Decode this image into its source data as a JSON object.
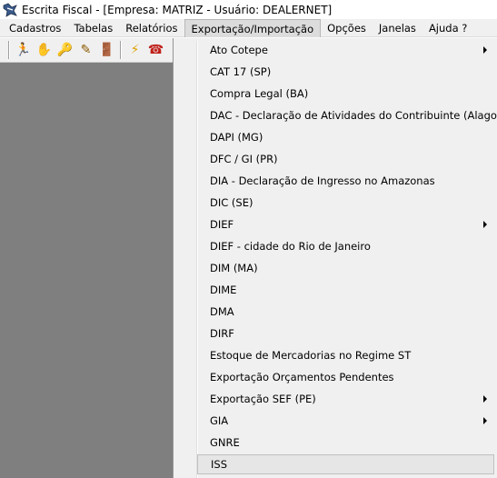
{
  "window": {
    "title": "Escrita Fiscal - [Empresa: MATRIZ - Usuário: DEALERNET]"
  },
  "menubar": {
    "items": [
      {
        "label": "Cadastros"
      },
      {
        "label": "Tabelas"
      },
      {
        "label": "Relatórios"
      },
      {
        "label": "Exportação/Importação"
      },
      {
        "label": "Opções"
      },
      {
        "label": "Janelas"
      },
      {
        "label": "Ajuda ?"
      }
    ],
    "active_index": 3
  },
  "toolbar": {
    "buttons": [
      {
        "icon": "runner-exit-icon",
        "glyph": "🏃"
      },
      {
        "icon": "hand-icon",
        "glyph": "✋"
      },
      {
        "icon": "door-key-icon",
        "glyph": "🔑"
      },
      {
        "icon": "pencil-edit-icon",
        "glyph": "✎"
      },
      {
        "icon": "door-exit-icon",
        "glyph": "🚪"
      },
      {
        "icon": "lightning-icon",
        "glyph": "⚡"
      },
      {
        "icon": "telephone-icon",
        "glyph": "☎"
      }
    ]
  },
  "dropdown": {
    "items": [
      {
        "label": "Ato Cotepe",
        "submenu": true
      },
      {
        "label": "CAT 17 (SP)",
        "submenu": false
      },
      {
        "label": "Compra Legal (BA)",
        "submenu": false
      },
      {
        "label": "DAC - Declaração de Atividades do Contribuinte (Alagoas)",
        "submenu": false
      },
      {
        "label": "DAPI (MG)",
        "submenu": false
      },
      {
        "label": "DFC / GI (PR)",
        "submenu": false
      },
      {
        "label": "DIA - Declaração de Ingresso no Amazonas",
        "submenu": false
      },
      {
        "label": "DIC (SE)",
        "submenu": false
      },
      {
        "label": "DIEF",
        "submenu": true
      },
      {
        "label": "DIEF - cidade do Rio de Janeiro",
        "submenu": false
      },
      {
        "label": "DIM (MA)",
        "submenu": false
      },
      {
        "label": "DIME",
        "submenu": false
      },
      {
        "label": "DMA",
        "submenu": false
      },
      {
        "label": "DIRF",
        "submenu": false
      },
      {
        "label": "Estoque de Mercadorias no Regime ST",
        "submenu": false
      },
      {
        "label": "Exportação Orçamentos Pendentes",
        "submenu": false
      },
      {
        "label": "Exportação SEF (PE)",
        "submenu": true
      },
      {
        "label": "GIA",
        "submenu": true
      },
      {
        "label": "GNRE",
        "submenu": false
      },
      {
        "label": "ISS",
        "submenu": false,
        "hovered": true
      }
    ]
  },
  "colors": {
    "workspace": "#7f7f7f",
    "menu_bg": "#f0f0f0",
    "hover_bg": "#e6e6e6"
  }
}
